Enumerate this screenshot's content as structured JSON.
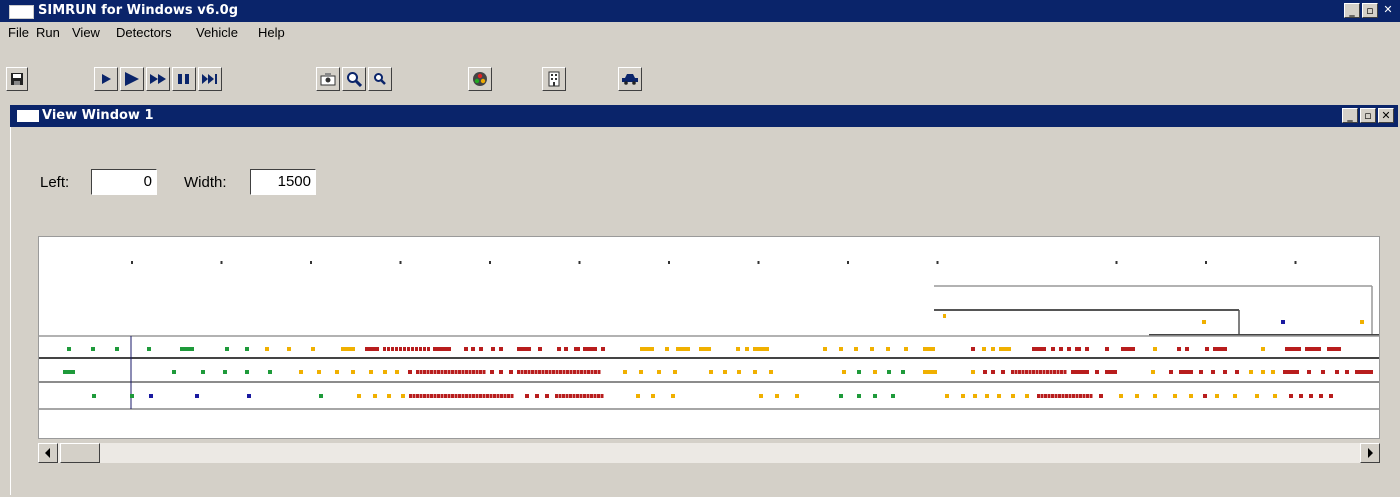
{
  "app": {
    "title": "SIMRUN for Windows v6.0g"
  },
  "window_controls": {
    "minimize": "_",
    "restore": "▫",
    "close": "✕"
  },
  "menu": [
    {
      "label": "File"
    },
    {
      "label": "Run"
    },
    {
      "label": "View"
    },
    {
      "label": "Detectors"
    },
    {
      "label": "Vehicle"
    },
    {
      "label": "Help"
    }
  ],
  "toolbar": [
    {
      "icon": "save-icon"
    },
    {
      "icon": "play-icon"
    },
    {
      "icon": "play-fast-icon"
    },
    {
      "icon": "fast-forward-icon"
    },
    {
      "icon": "pause-icon"
    },
    {
      "icon": "step-forward-icon"
    },
    {
      "icon": "camera-icon"
    },
    {
      "icon": "zoom-in-icon"
    },
    {
      "icon": "zoom-out-icon"
    },
    {
      "icon": "color-palette-icon"
    },
    {
      "icon": "building-icon"
    },
    {
      "icon": "vehicle-icon"
    }
  ],
  "view_window": {
    "title": "View Window 1",
    "left_label": "Left:",
    "left_value": "0",
    "width_label": "Width:",
    "width_value": "1500"
  },
  "colors": {
    "titlebar": "#0a246a",
    "vehicle_red": "#b81d1d",
    "vehicle_green": "#1e9a3a",
    "vehicle_yellow": "#f0b000",
    "vehicle_blue": "#1a1aa0"
  },
  "scrollbar": {
    "left_arrow": "◀",
    "right_arrow": "▶"
  }
}
